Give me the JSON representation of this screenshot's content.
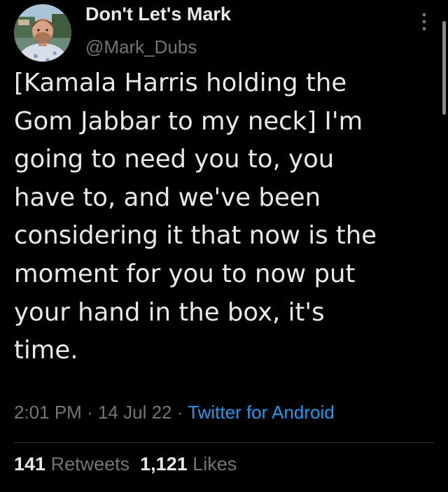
{
  "author": {
    "display_name": "Don't Let's Mark",
    "handle": "@Mark_Dubs",
    "avatar_icon": "user-photo-avatar"
  },
  "tweet": {
    "lines": [
      "[Kamala Harris holding the",
      "Gom Jabbar to my neck] I'm",
      "going to need you to, you",
      "have to, and we've been",
      "considering it that now is the",
      "moment for you to now put",
      "your hand in the box, it's",
      "time."
    ],
    "time": "2:01 PM",
    "date": "14 Jul 22",
    "separator": "·",
    "source": "Twitter for Android"
  },
  "stats": {
    "retweets_count": "141",
    "retweets_label": "Retweets",
    "likes_count": "1,121",
    "likes_label": "Likes"
  },
  "colors": {
    "background": "#000000",
    "text_primary": "#e7e9ea",
    "text_secondary": "#71767b",
    "link": "#1d9bf0",
    "divider": "#2f3336"
  },
  "icons": {
    "more": "vertical-ellipsis-icon"
  }
}
